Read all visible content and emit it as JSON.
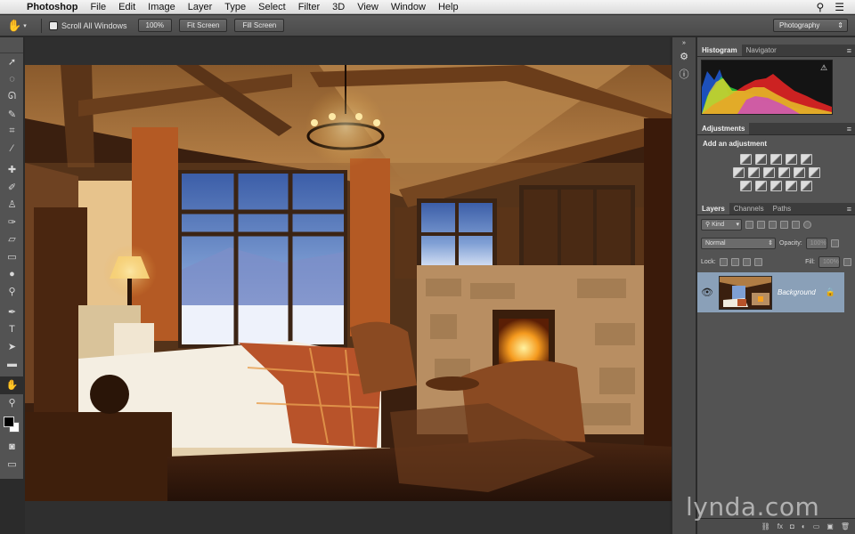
{
  "menubar": {
    "app": "Photoshop",
    "items": [
      "File",
      "Edit",
      "Image",
      "Layer",
      "Type",
      "Select",
      "Filter",
      "3D",
      "View",
      "Window",
      "Help"
    ]
  },
  "options": {
    "scroll_all_windows": "Scroll All Windows",
    "btn_100": "100%",
    "btn_fit": "Fit Screen",
    "btn_fill": "Fill Screen",
    "workspace": "Photography"
  },
  "panels": {
    "top_tabs": [
      "Histogram",
      "Navigator"
    ],
    "adjustments_tab": "Adjustments",
    "add_adjustment": "Add an adjustment",
    "layer_tabs": [
      "Layers",
      "Channels",
      "Paths"
    ],
    "kind": "Kind",
    "blend_mode": "Normal",
    "opacity_label": "Opacity:",
    "opacity_value": "100%",
    "lock_label": "Lock:",
    "fill_label": "Fill:",
    "fill_value": "100%",
    "layer_name": "Background"
  },
  "watermark": "lynda.com",
  "icons": {
    "tools": [
      "move-icon",
      "marquee-icon",
      "lasso-icon",
      "quick-select-icon",
      "crop-icon",
      "eyedropper-icon",
      "healing-icon",
      "brush-icon",
      "stamp-icon",
      "history-brush-icon",
      "eraser-icon",
      "gradient-icon",
      "blur-icon",
      "dodge-icon",
      "pen-icon",
      "type-icon",
      "path-select-icon",
      "shape-icon",
      "hand-icon",
      "zoom-icon"
    ]
  },
  "colors": {
    "foreground": "#000000",
    "background": "#ffffff",
    "selected_layer": "#8aa0b8"
  }
}
